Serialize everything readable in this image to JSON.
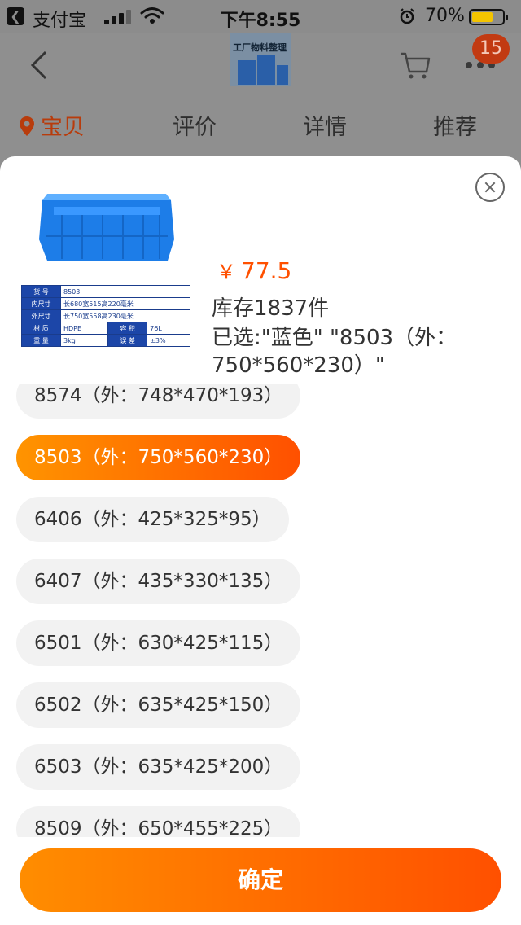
{
  "status_bar": {
    "back_app": "支付宝",
    "time": "下午8:55",
    "battery_percent": "70%",
    "battery_level": 0.7
  },
  "header": {
    "product_thumb_text": "工厂物料整理",
    "cart_badge": "15"
  },
  "tabs": [
    {
      "label": "宝贝",
      "active": true
    },
    {
      "label": "评价",
      "active": false
    },
    {
      "label": "详情",
      "active": false
    },
    {
      "label": "推荐",
      "active": false
    }
  ],
  "product": {
    "price_symbol": "￥",
    "price": "77.5",
    "stock": "库存1837件",
    "selected": "已选:\"蓝色\" \"8503（外：750*560*230）\""
  },
  "spec_table": {
    "rows": [
      [
        "货 号",
        "8503"
      ],
      [
        "内尺寸",
        "长680宽515高220毫米"
      ],
      [
        "外尺寸",
        "长750宽558高230毫米"
      ]
    ],
    "material_label": "材 质",
    "material": "HDPE",
    "volume_label": "容 积",
    "volume": "76L",
    "weight_label": "重 量",
    "weight": "3kg",
    "error_label": "误 差",
    "error": "±3%"
  },
  "options": [
    {
      "label": "8574（外：748*470*193）",
      "selected": false
    },
    {
      "label": "8503（外：750*560*230）",
      "selected": true
    },
    {
      "label": "6406（外：425*325*95）",
      "selected": false
    },
    {
      "label": "6407（外：435*330*135）",
      "selected": false
    },
    {
      "label": "6501（外：630*425*115）",
      "selected": false
    },
    {
      "label": "6502（外：635*425*150）",
      "selected": false
    },
    {
      "label": "6503（外：635*425*200）",
      "selected": false
    },
    {
      "label": "8509（外：650*455*225）",
      "selected": false
    }
  ],
  "confirm_label": "确定",
  "colors": {
    "accent": "#ff5000",
    "accent_gradient_start": "#ff9400",
    "tab_active": "#b83c0c",
    "overlay": "#8f8f8f"
  },
  "icons": [
    "back-app-icon",
    "signal-icon",
    "wifi-icon",
    "alarm-icon",
    "battery-icon",
    "back-arrow-icon",
    "cart-icon",
    "more-icon",
    "location-pin-icon",
    "close-icon"
  ]
}
